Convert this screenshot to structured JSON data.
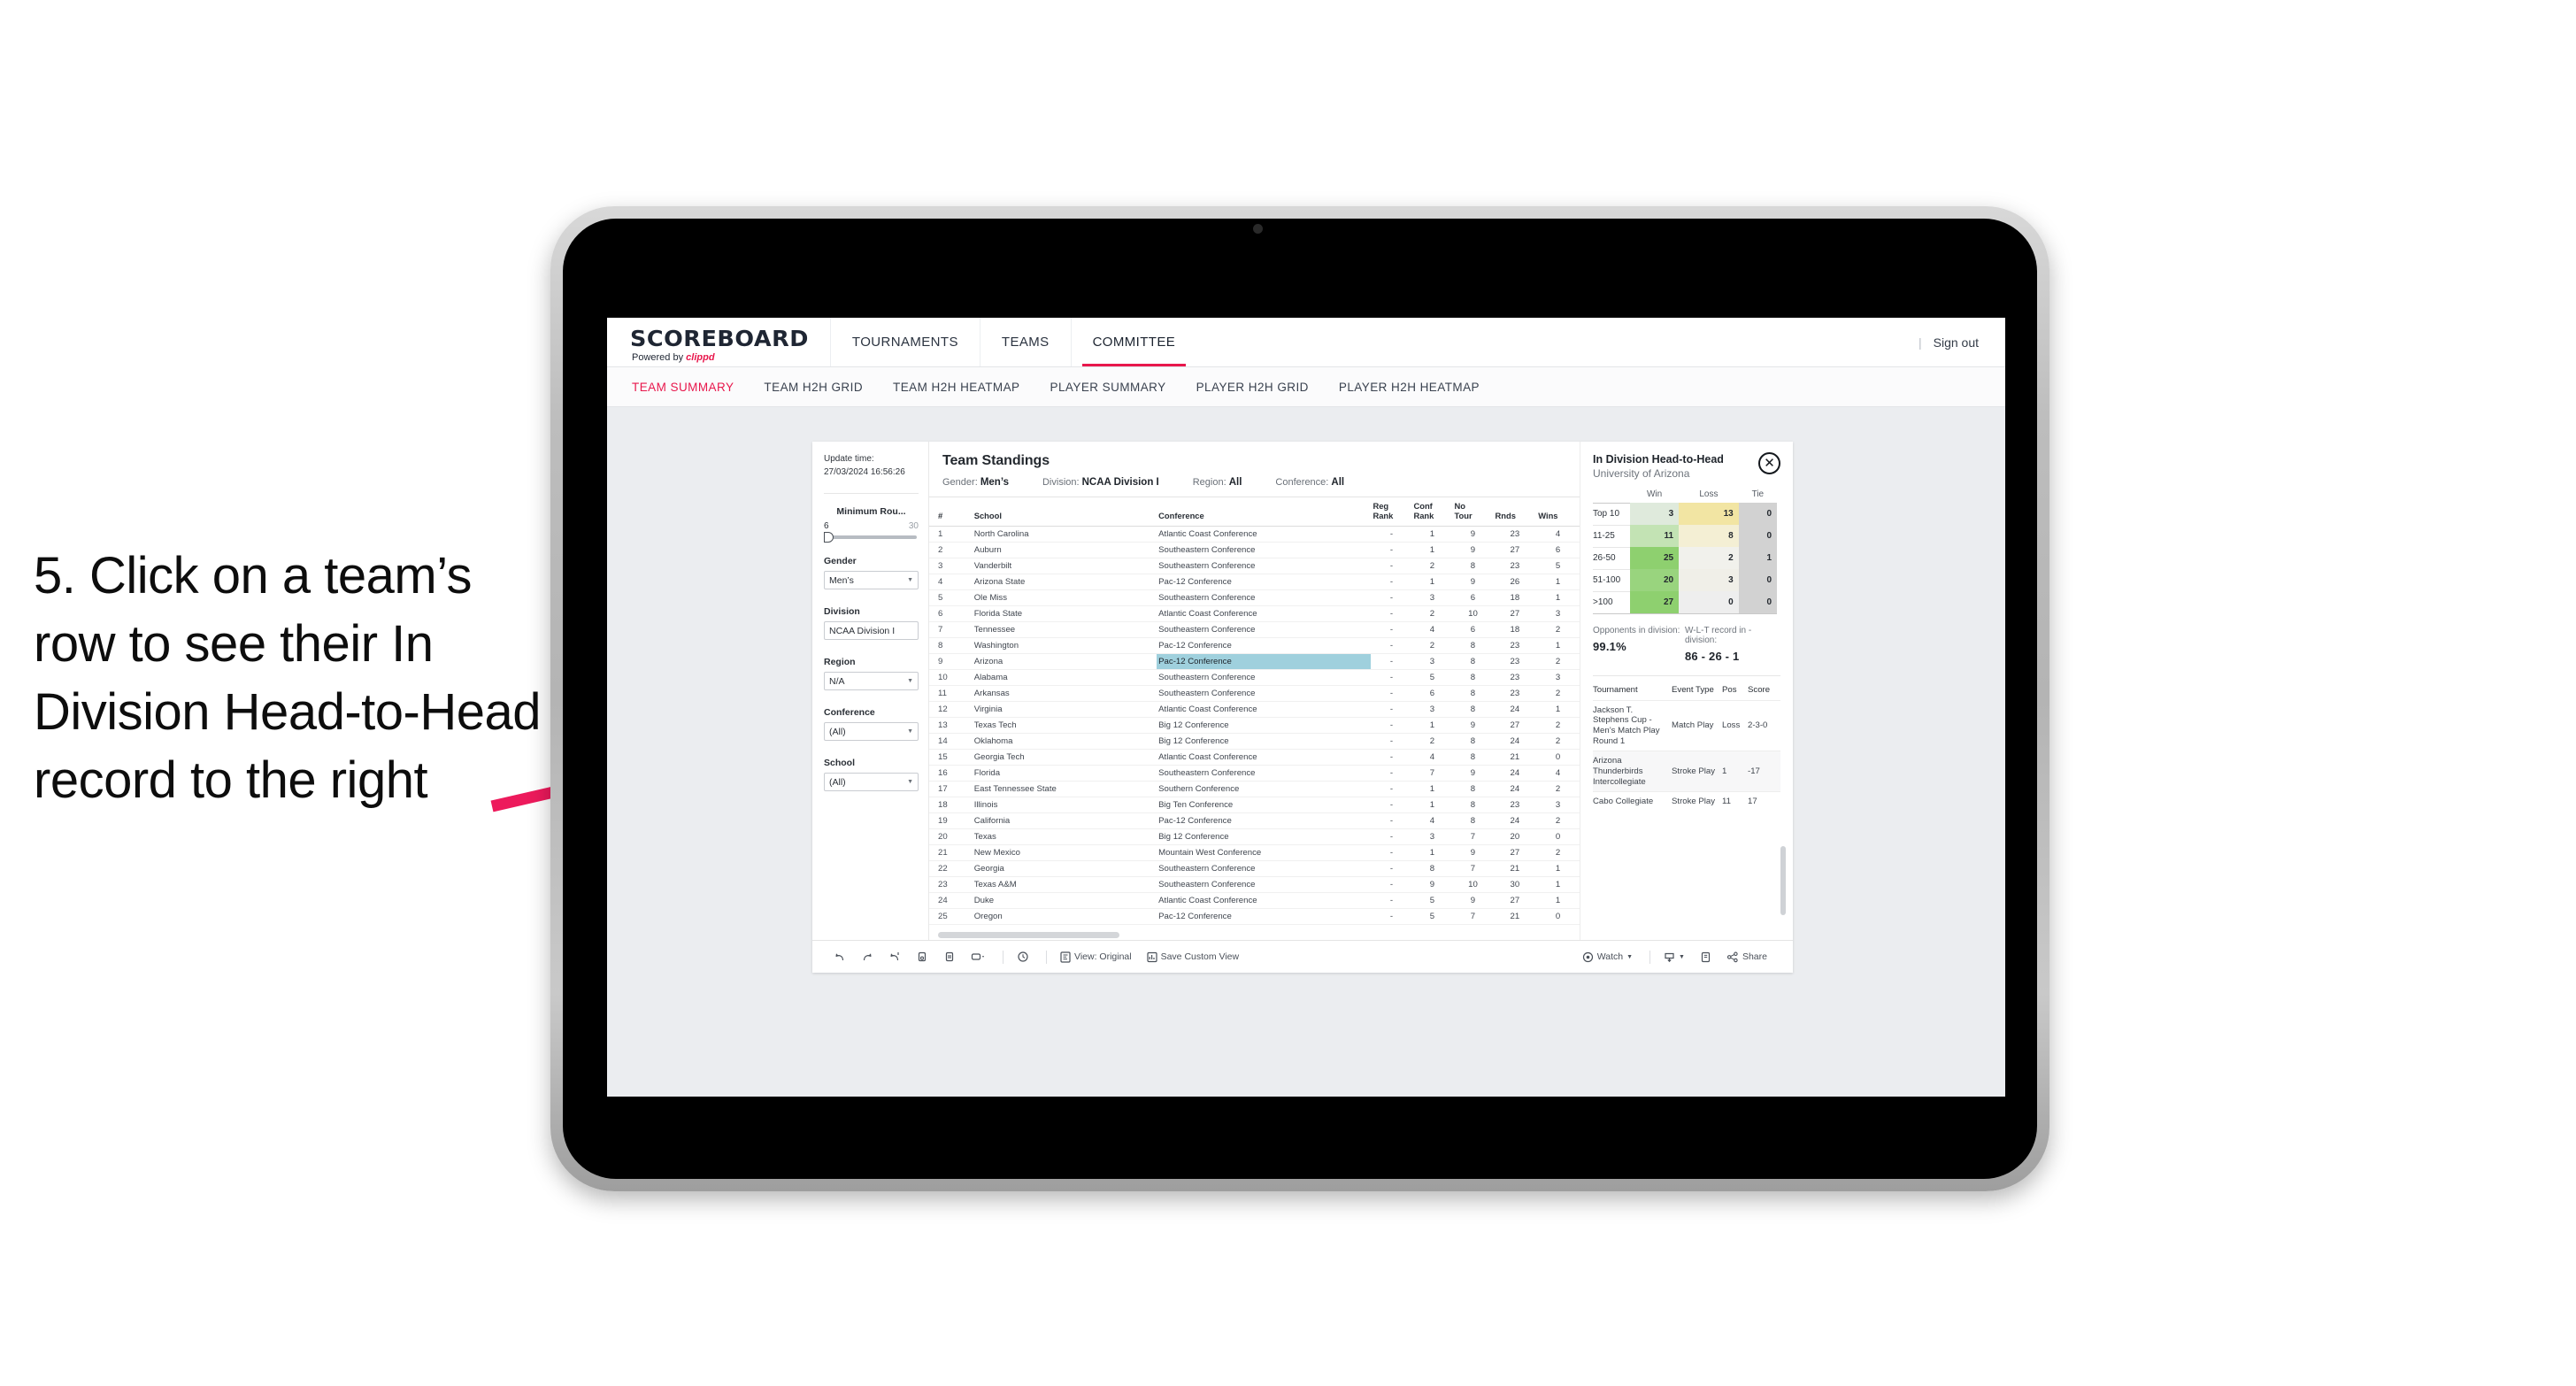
{
  "annotation": {
    "text": "5. Click on a team’s row to see their In Division Head-to-Head record to the right",
    "arrow_color": "#ed1a5c"
  },
  "app": {
    "brand": {
      "title": "SCOREBOARD",
      "powered_prefix": "Powered by ",
      "powered_brand": "clippd"
    },
    "topnav": [
      {
        "label": "TOURNAMENTS",
        "active": false
      },
      {
        "label": "TEAMS",
        "active": false
      },
      {
        "label": "COMMITTEE",
        "active": true
      }
    ],
    "signout": {
      "divider": "|",
      "label": "Sign out"
    },
    "subnav": [
      {
        "label": "TEAM SUMMARY",
        "active": true
      },
      {
        "label": "TEAM H2H GRID",
        "active": false
      },
      {
        "label": "TEAM H2H HEATMAP",
        "active": false
      },
      {
        "label": "PLAYER SUMMARY",
        "active": false
      },
      {
        "label": "PLAYER H2H GRID",
        "active": false
      },
      {
        "label": "PLAYER H2H HEATMAP",
        "active": false
      }
    ],
    "accent_color": "#e8174c"
  },
  "filters": {
    "update_time_label": "Update time:",
    "update_time_value": "27/03/2024 16:56:26",
    "min_rounds": {
      "label": "Minimum Rou...",
      "low": "6",
      "high": "30"
    },
    "groups": [
      {
        "label": "Gender",
        "value": "Men’s"
      },
      {
        "label": "Division",
        "value": "NCAA Division I"
      },
      {
        "label": "Region",
        "value": "N/A"
      },
      {
        "label": "Conference",
        "value": "(All)"
      },
      {
        "label": "School",
        "value": "(All)"
      }
    ]
  },
  "standings": {
    "title": "Team Standings",
    "meta": [
      {
        "label": "Gender:",
        "value": "Men’s"
      },
      {
        "label": "Division:",
        "value": "NCAA Division I"
      },
      {
        "label": "Region:",
        "value": "All"
      },
      {
        "label": "Conference:",
        "value": "All"
      }
    ],
    "columns": [
      "#",
      "School",
      "Conference",
      "Reg Rank",
      "Conf Rank",
      "No Tour",
      "Rnds",
      "Wins"
    ],
    "highlighted_row_index": 8,
    "highlight_color": "#9fd0dd",
    "rows": [
      [
        "1",
        "North Carolina",
        "Atlantic Coast Conference",
        "-",
        "1",
        "9",
        "23",
        "4"
      ],
      [
        "2",
        "Auburn",
        "Southeastern Conference",
        "-",
        "1",
        "9",
        "27",
        "6"
      ],
      [
        "3",
        "Vanderbilt",
        "Southeastern Conference",
        "-",
        "2",
        "8",
        "23",
        "5"
      ],
      [
        "4",
        "Arizona State",
        "Pac-12 Conference",
        "-",
        "1",
        "9",
        "26",
        "1"
      ],
      [
        "5",
        "Ole Miss",
        "Southeastern Conference",
        "-",
        "3",
        "6",
        "18",
        "1"
      ],
      [
        "6",
        "Florida State",
        "Atlantic Coast Conference",
        "-",
        "2",
        "10",
        "27",
        "3"
      ],
      [
        "7",
        "Tennessee",
        "Southeastern Conference",
        "-",
        "4",
        "6",
        "18",
        "2"
      ],
      [
        "8",
        "Washington",
        "Pac-12 Conference",
        "-",
        "2",
        "8",
        "23",
        "1"
      ],
      [
        "9",
        "Arizona",
        "Pac-12 Conference",
        "-",
        "3",
        "8",
        "23",
        "2"
      ],
      [
        "10",
        "Alabama",
        "Southeastern Conference",
        "-",
        "5",
        "8",
        "23",
        "3"
      ],
      [
        "11",
        "Arkansas",
        "Southeastern Conference",
        "-",
        "6",
        "8",
        "23",
        "2"
      ],
      [
        "12",
        "Virginia",
        "Atlantic Coast Conference",
        "-",
        "3",
        "8",
        "24",
        "1"
      ],
      [
        "13",
        "Texas Tech",
        "Big 12 Conference",
        "-",
        "1",
        "9",
        "27",
        "2"
      ],
      [
        "14",
        "Oklahoma",
        "Big 12 Conference",
        "-",
        "2",
        "8",
        "24",
        "2"
      ],
      [
        "15",
        "Georgia Tech",
        "Atlantic Coast Conference",
        "-",
        "4",
        "8",
        "21",
        "0"
      ],
      [
        "16",
        "Florida",
        "Southeastern Conference",
        "-",
        "7",
        "9",
        "24",
        "4"
      ],
      [
        "17",
        "East Tennessee State",
        "Southern Conference",
        "-",
        "1",
        "8",
        "24",
        "2"
      ],
      [
        "18",
        "Illinois",
        "Big Ten Conference",
        "-",
        "1",
        "8",
        "23",
        "3"
      ],
      [
        "19",
        "California",
        "Pac-12 Conference",
        "-",
        "4",
        "8",
        "24",
        "2"
      ],
      [
        "20",
        "Texas",
        "Big 12 Conference",
        "-",
        "3",
        "7",
        "20",
        "0"
      ],
      [
        "21",
        "New Mexico",
        "Mountain West Conference",
        "-",
        "1",
        "9",
        "27",
        "2"
      ],
      [
        "22",
        "Georgia",
        "Southeastern Conference",
        "-",
        "8",
        "7",
        "21",
        "1"
      ],
      [
        "23",
        "Texas A&M",
        "Southeastern Conference",
        "-",
        "9",
        "10",
        "30",
        "1"
      ],
      [
        "24",
        "Duke",
        "Atlantic Coast Conference",
        "-",
        "5",
        "9",
        "27",
        "1"
      ],
      [
        "25",
        "Oregon",
        "Pac-12 Conference",
        "-",
        "5",
        "7",
        "21",
        "0"
      ]
    ]
  },
  "h2h": {
    "title": "In Division Head-to-Head",
    "subtitle": "University of Arizona",
    "close_icon": "✕",
    "matrix": {
      "columns": [
        "Win",
        "Loss",
        "Tie"
      ],
      "rows": [
        {
          "label": "Top 10",
          "win": "3",
          "loss": "13",
          "tie": "0",
          "win_color": "#dfeadc",
          "loss_color": "#f2e5a3",
          "tie_color": "#d2d2d2"
        },
        {
          "label": "11-25",
          "win": "11",
          "loss": "8",
          "tie": "0",
          "win_color": "#c3e3b4",
          "loss_color": "#f4efd4",
          "tie_color": "#d2d2d2"
        },
        {
          "label": "26-50",
          "win": "25",
          "loss": "2",
          "tie": "1",
          "win_color": "#8ed06f",
          "loss_color": "#f1f1ec",
          "tie_color": "#d2d2d2"
        },
        {
          "label": "51-100",
          "win": "20",
          "loss": "3",
          "tie": "0",
          "win_color": "#99d47e",
          "loss_color": "#f0efe8",
          "tie_color": "#d2d2d2"
        },
        {
          "label": ">100",
          "win": "27",
          "loss": "0",
          "tie": "0",
          "win_color": "#8ed06f",
          "loss_color": "#eeeeee",
          "tie_color": "#d2d2d2"
        }
      ]
    },
    "stats": [
      {
        "label": "Opponents in division:",
        "value": "99.1%"
      },
      {
        "label": "W-L-T record in -division:",
        "value": "86 - 26 - 1"
      }
    ],
    "tournaments": {
      "columns": [
        "Tournament",
        "Event Type",
        "Pos",
        "Score"
      ],
      "rows": [
        [
          "Jackson T. Stephens Cup - Men’s Match Play Round 1",
          "Match Play",
          "Loss",
          "2-3-0"
        ],
        [
          "Arizona Thunderbirds Intercollegiate",
          "Stroke Play",
          "1",
          "-17"
        ],
        [
          "Cabo Collegiate",
          "Stroke Play",
          "11",
          "17"
        ]
      ]
    }
  },
  "toolbar": {
    "view_label": "View: Original",
    "save_label": "Save Custom View",
    "watch_label": "Watch",
    "share_label": "Share"
  }
}
